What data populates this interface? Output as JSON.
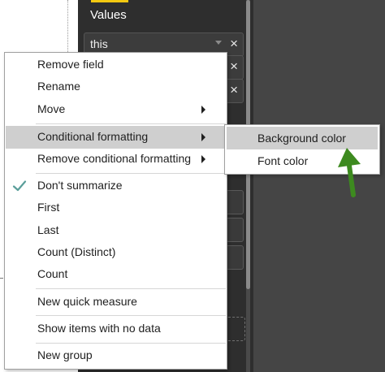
{
  "pane": {
    "title": "Values",
    "fields": [
      {
        "name": "this",
        "remove": "×"
      },
      {
        "name": "",
        "remove": "×"
      },
      {
        "name": "",
        "remove": "×"
      }
    ]
  },
  "menu": {
    "items": [
      {
        "label": "Remove field"
      },
      {
        "label": "Rename"
      },
      {
        "label": "Move"
      },
      {
        "label": "Conditional formatting"
      },
      {
        "label": "Remove conditional formatting"
      },
      {
        "label": "Don't summarize"
      },
      {
        "label": "First"
      },
      {
        "label": "Last"
      },
      {
        "label": "Count (Distinct)"
      },
      {
        "label": "Count"
      },
      {
        "label": "New quick measure"
      },
      {
        "label": "Show items with no data"
      },
      {
        "label": "New group"
      }
    ]
  },
  "submenu": {
    "items": [
      {
        "label": "Background color"
      },
      {
        "label": "Font color"
      }
    ]
  },
  "colors": {
    "accent": "#f2c811",
    "check": "#5a9e9a",
    "arrow": "#3d8a1f",
    "highlight": "#cfcfcf"
  }
}
